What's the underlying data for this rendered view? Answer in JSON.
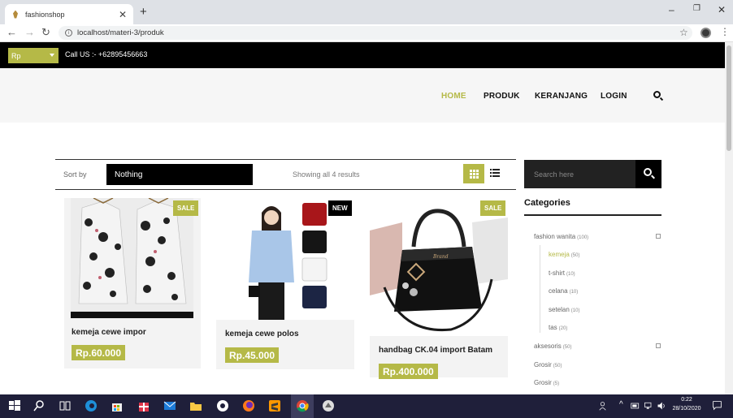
{
  "browser": {
    "tab_title": "fashionshop",
    "tab_close": "✕",
    "new_tab": "+",
    "url": "localhost/materi-3/produk",
    "minimize": "–",
    "maximize": "❐",
    "close": "✕"
  },
  "topbar": {
    "currency": "Rp",
    "call_us": "Call US :- +62895456663"
  },
  "nav": {
    "home": "HOME",
    "produk": "PRODUK",
    "keranjang": "KERANJANG",
    "login": "LOGIN"
  },
  "sortbar": {
    "sort_label": "Sort by",
    "sort_value": "Nothing",
    "showing": "Showing all 4 results"
  },
  "products": [
    {
      "name": "kemeja cewe impor",
      "price": "Rp.60.000",
      "badge": "SALE"
    },
    {
      "name": "kemeja cewe polos",
      "price": "Rp.45.000",
      "badge": "NEW"
    },
    {
      "name": "handbag CK.04 import Batam",
      "price": "Rp.400.000",
      "badge": "SALE"
    }
  ],
  "sidebar": {
    "search_placeholder": "Search here",
    "categories_title": "Categories",
    "categories": [
      {
        "label": "fashion wanita",
        "count": "(100)"
      },
      {
        "label": "kemeja",
        "count": "(50)"
      },
      {
        "label": "t-shirt",
        "count": "(10)"
      },
      {
        "label": "celana",
        "count": "(10)"
      },
      {
        "label": "setelan",
        "count": "(10)"
      },
      {
        "label": "tas",
        "count": "(20)"
      },
      {
        "label": "aksesoris",
        "count": "(50)"
      },
      {
        "label": "Grosir",
        "count": "(50)"
      },
      {
        "label": "Grosir",
        "count": "(5)"
      }
    ]
  },
  "taskbar": {
    "time": "0:22",
    "date": "28/10/2020"
  },
  "colors": {
    "accent": "#b5b947",
    "dark": "#000000"
  }
}
